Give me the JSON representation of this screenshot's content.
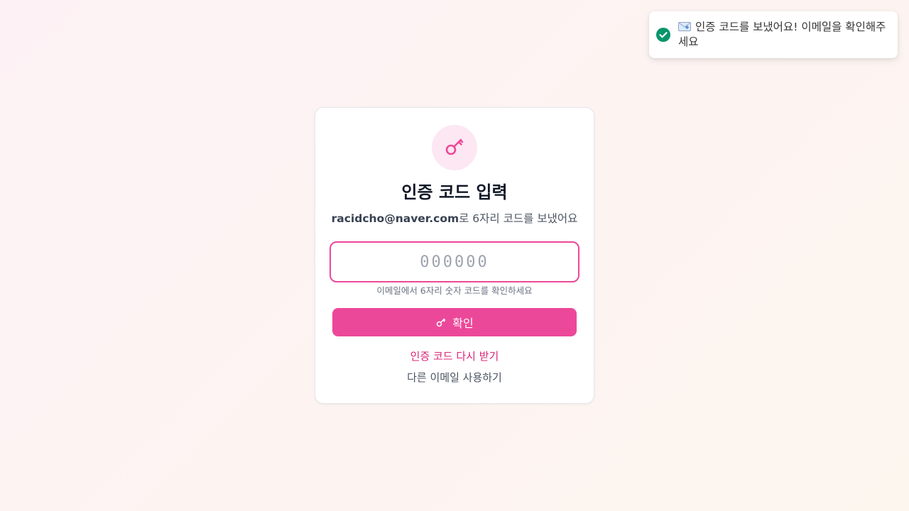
{
  "toast": {
    "icon": "check-circle-icon",
    "emoji": "envelope-icon",
    "message": "인증 코드를 보냈어요! 이메일을 확인해주세요",
    "color": "#059669"
  },
  "card": {
    "icon": "key-icon",
    "title": "인증 코드 입력",
    "email": "racidcho@naver.com",
    "subtitle_suffix": "로 6자리 코드를 보냈어요",
    "code_input": {
      "value": "",
      "placeholder": "000000"
    },
    "hint": "이메일에서 6자리 숫자 코드를 확인하세요",
    "confirm_button": {
      "icon": "key-icon",
      "label": "확인"
    },
    "resend_link": "인증 코드 다시 받기",
    "change_email_link": "다른 이메일 사용하기"
  },
  "colors": {
    "accent": "#ec4899",
    "accent_light": "#fce7f3",
    "link": "#db2777"
  }
}
